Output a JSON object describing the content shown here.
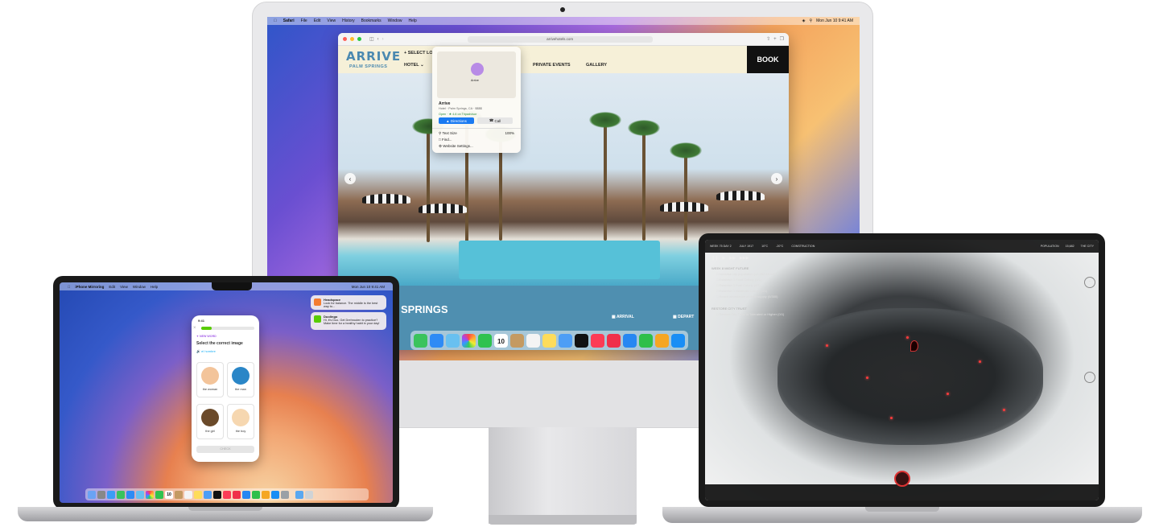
{
  "imac": {
    "menubar": {
      "app": "Safari",
      "items": [
        "File",
        "Edit",
        "View",
        "History",
        "Bookmarks",
        "Window",
        "Help"
      ],
      "clock": "Mon Jun 10  9:41 AM"
    },
    "safari": {
      "url": "arrivehotels.com",
      "site": {
        "logo": "ARRIVE",
        "logo_sub": "PALM SPRINGS",
        "select_location": "SELECT LO",
        "nav": [
          "HOTEL",
          "PRIVATE EVENTS",
          "GALLERY"
        ],
        "book": "BOOK",
        "banner_title": "SPRINGS",
        "tag_arrival": "ARRIVAL",
        "tag_depart": "DEPART"
      },
      "popover": {
        "place": "Arrive",
        "address": "Hotel · Palm Springs, CA · $$$$",
        "status": "Open · ★ 4.6 on Tripadvisor",
        "map_label": "Arrive",
        "directions": "Directions",
        "call": "Call",
        "text_size": "Text Size",
        "text_size_value": "100%",
        "find": "Find...",
        "website_settings": "Website Settings..."
      }
    },
    "dock_calendar_day": "10"
  },
  "macbook_air": {
    "menubar": {
      "app": "iPhone Mirroring",
      "items": [
        "Edit",
        "View",
        "Window",
        "Help"
      ],
      "clock": "Mon Jun 10 9:41 AM"
    },
    "notifications": [
      {
        "app": "Headspace",
        "text": "Look for balance. The middle is the best way to..."
      },
      {
        "app": "Duolingo",
        "title": "Hi, it's Duo.",
        "text": "Get Drehrouten to practice? Make time for a healthy habit in your day!"
      }
    ],
    "phone": {
      "time": "9:41",
      "badge": "NEW WORD",
      "prompt": "Select the correct image",
      "word": "el hombre",
      "choices": [
        "the woman",
        "the man",
        "the girl",
        "the boy"
      ],
      "progress": 0.2,
      "check": "CHECK"
    },
    "dock_calendar_day": "10"
  },
  "macbook_pro": {
    "hud": {
      "date": "WEEK 75 DAY 2",
      "time": "JULY 1917",
      "weather": "10°C",
      "heat": "-20°C",
      "mode": "CONSTRUCTION",
      "population_label": "POPULATION",
      "population": "15,682",
      "city": "THE CITY"
    },
    "objectives": {
      "title": "WEEK 8 MIGHT FUTURE",
      "items": [
        "Increase city population (13,282/48,000)",
        "Establish 1 Food Colony (0/1)",
        "Establish 1 Fuel Colony (0/1)",
        "Establish 1 Materials Colony (0/1)",
        "Reach abundance of Heat supply (0/300)"
      ],
      "title2": "RESTORE CITY TRUST",
      "items2": [
        "Restore City Trust to Tolerated or Higher (0/1)"
      ]
    }
  }
}
